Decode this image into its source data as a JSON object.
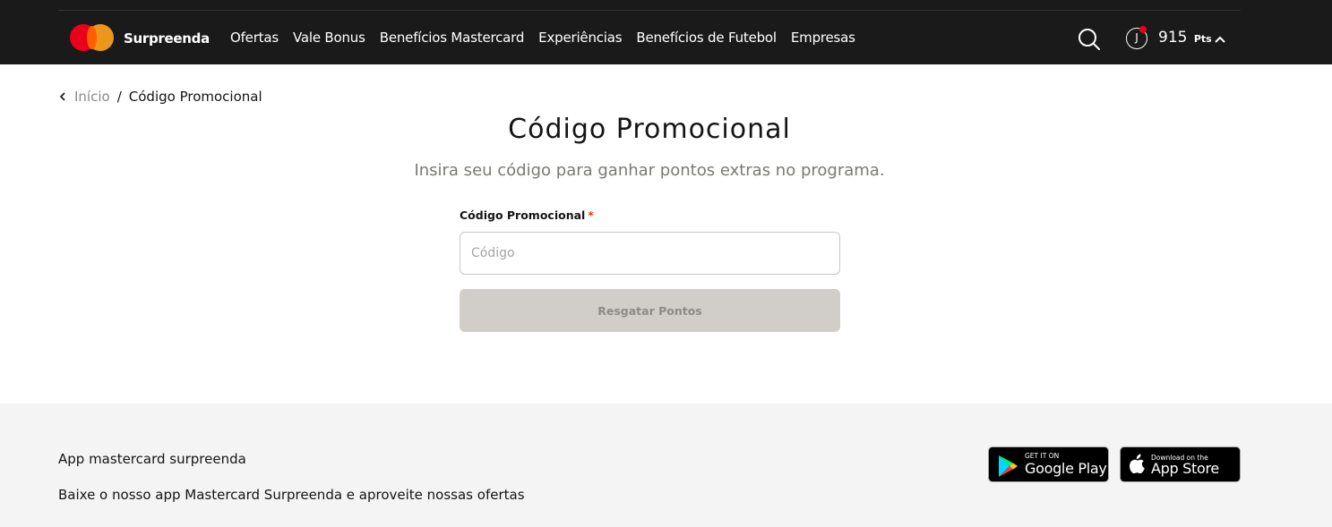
{
  "header": {
    "brand": "Surpreenda",
    "nav": [
      "Ofertas",
      "Vale Bonus",
      "Benefícios Mastercard",
      "Experiências",
      "Benefícios de Futebol",
      "Empresas"
    ],
    "avatar_initial": "J",
    "points_value": "915",
    "points_unit": "Pts",
    "icons": [
      "mastercard-logo",
      "search-icon",
      "chevron-up-icon"
    ]
  },
  "breadcrumb": {
    "home": "Início",
    "separator": "/",
    "current": "Código Promocional"
  },
  "main": {
    "title": "Código Promocional",
    "subtitle": "Insira seu código para ganhar pontos extras no programa.",
    "field_label": "Código Promocional",
    "required_marker": "*",
    "input_placeholder": "Código",
    "input_value": "",
    "button_label": "Resgatar Pontos"
  },
  "footer": {
    "title": "App mastercard surpreenda",
    "description": "Baixe o nosso app Mastercard Surpreenda e aproveite nossas ofertas",
    "google_small": "GET IT ON",
    "google_big": "Google Play",
    "apple_small": "Download on the",
    "apple_big": "App Store"
  },
  "colors": {
    "header_bg": "#1a1a1a",
    "mc_red": "#eb001b",
    "mc_orange": "#f79e1b",
    "required": "#cf4500",
    "button_disabled_bg": "#d1cec9",
    "footer_bg": "#f4f4f4"
  }
}
